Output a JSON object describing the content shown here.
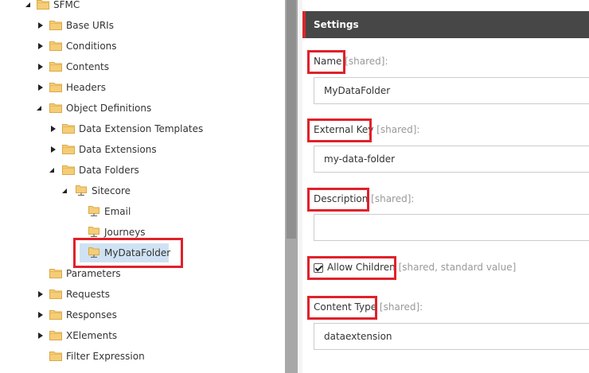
{
  "tree": {
    "root": "SFMC",
    "items": {
      "base_uris": "Base URIs",
      "conditions": "Conditions",
      "contents": "Contents",
      "headers": "Headers",
      "object_definitions": "Object Definitions",
      "data_extension_templates": "Data Extension Templates",
      "data_extensions": "Data Extensions",
      "data_folders": "Data Folders",
      "sitecore": "Sitecore",
      "email": "Email",
      "journeys": "Journeys",
      "mydatafolder": "MyDataFolder",
      "parameters": "Parameters",
      "requests": "Requests",
      "responses": "Responses",
      "xelements": "XElements",
      "filter_expression": "Filter Expression"
    }
  },
  "settings": {
    "title": "Settings",
    "name": {
      "label": "Name",
      "note": " [shared]:",
      "value": "MyDataFolder"
    },
    "external_key": {
      "label": "External Key",
      "note": " [shared]:",
      "value": "my-data-folder"
    },
    "description": {
      "label": "Description",
      "note": " [shared]:",
      "value": ""
    },
    "allow_children": {
      "label": "Allow Children",
      "note": " [shared, standard value]",
      "checked": true
    },
    "content_type": {
      "label": "Content Type",
      "note": " [shared]:",
      "value": "dataextension"
    }
  },
  "colors": {
    "highlight_red": "#e0212a",
    "settings_bar": "#474747",
    "accent": "#d9262c",
    "selection": "#cfe2f3",
    "folder": "#f0c36d"
  }
}
